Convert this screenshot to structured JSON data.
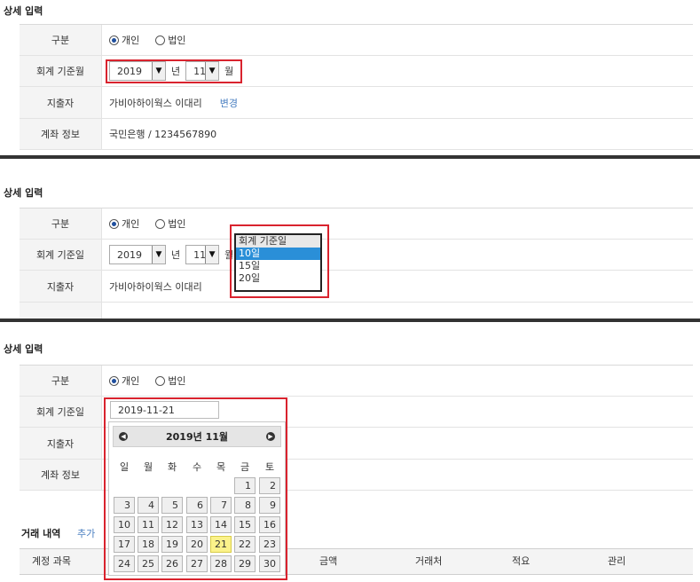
{
  "section_title": "상세 입력",
  "labels": {
    "type": "구분",
    "base_month": "회계 기준월",
    "base_day": "회계 기준일",
    "payer": "지출자",
    "account": "계좌 정보"
  },
  "radio": {
    "individual": "개인",
    "corporate": "법인"
  },
  "year_value": "2019",
  "year_unit": "년",
  "month_value": "11",
  "month_unit": "월",
  "payer_value": "가비아하이웍스 이대리",
  "change_link": "변경",
  "account_value": "국민은행 / 1234567890",
  "dropdown": {
    "header": "회계 기준일",
    "options": [
      "10일",
      "15일",
      "20일"
    ],
    "selected": "10일"
  },
  "date_value": "2019-11-21",
  "calendar": {
    "title": "2019년 11월",
    "weekdays": [
      "일",
      "월",
      "화",
      "수",
      "목",
      "금",
      "토"
    ],
    "first_row": [
      "1",
      "2"
    ],
    "weeks": [
      [
        "3",
        "4",
        "5",
        "6",
        "7",
        "8",
        "9"
      ],
      [
        "10",
        "11",
        "12",
        "13",
        "14",
        "15",
        "16"
      ],
      [
        "17",
        "18",
        "19",
        "20",
        "21",
        "22",
        "23"
      ],
      [
        "24",
        "25",
        "26",
        "27",
        "28",
        "29",
        "30"
      ]
    ],
    "today": "21"
  },
  "transactions": {
    "title": "거래 내역",
    "add_link": "추가",
    "columns": [
      "계정 과목",
      "금액",
      "거래처",
      "적요",
      "관리"
    ]
  },
  "colors": {
    "highlight_red": "#d9232e",
    "link_blue": "#4a7fc1",
    "select_blue": "#2a8fd8",
    "today_yellow": "#fbf28a"
  }
}
